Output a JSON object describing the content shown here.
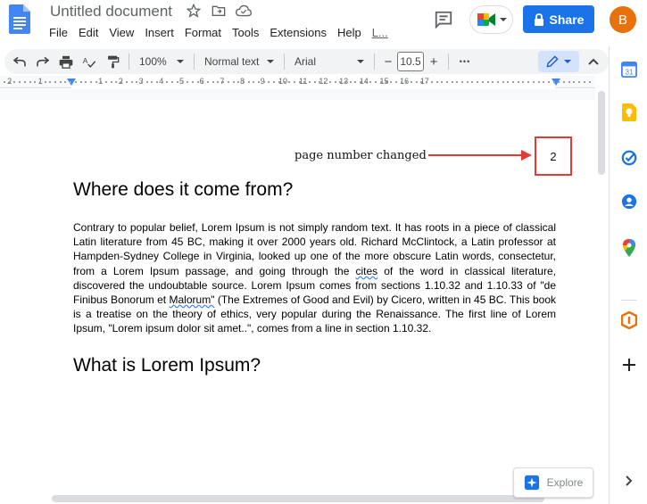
{
  "doc": {
    "title": "Untitled document"
  },
  "menu": [
    "File",
    "Edit",
    "View",
    "Insert",
    "Format",
    "Tools",
    "Extensions",
    "Help",
    "L..."
  ],
  "share": {
    "label": "Share"
  },
  "user": {
    "initial": "B",
    "color": "#e8710a"
  },
  "toolbar": {
    "zoom": "100%",
    "style": "Normal text",
    "font": "Arial",
    "font_size": "10.5",
    "minus": "−",
    "plus": "+",
    "more": "•••"
  },
  "ruler": {
    "numbers": [
      "2",
      "1",
      "1",
      "2",
      "3",
      "4",
      "5",
      "6",
      "7",
      "8",
      "9",
      "10",
      "11",
      "12",
      "13",
      "14",
      "15",
      "16",
      "17"
    ]
  },
  "page": {
    "annotation": "page number changed",
    "page_number": "2",
    "heading1": "Where does it come from?",
    "paragraph_parts": {
      "before_cites": "Contrary to popular belief, Lorem Ipsum is not simply random text. It has roots in a piece of classical Latin literature from 45 BC, making it over 2000 years old. Richard McClintock, a Latin professor at Hampden-Sydney College in Virginia, looked up one of the more obscure Latin words, consectetur, from a Lorem Ipsum passage, and going through the ",
      "cites": "cites",
      "after_cites": " of the word in classical literature, discovered the undoubtable source. Lorem Ipsum comes from sections 1.10.32 and 1.10.33 of \"de Finibus Bonorum et ",
      "malorum": "Malorum\"",
      "after_malorum": " (The Extremes of Good and Evil) by Cicero, written in 45 BC. This book is a treatise on the theory of ethics, very popular during the Renaissance. The first line of Lorem Ipsum, \"Lorem ipsum dolor sit amet..\", comes from a line in section 1.10.32."
    },
    "heading2": "What is Lorem Ipsum?"
  },
  "explore": {
    "label": "Explore"
  },
  "colors": {
    "accent": "#1a73e8",
    "annotation_red": "#e53935"
  },
  "side_panel": [
    "calendar-icon",
    "keep-icon",
    "tasks-icon",
    "contacts-icon",
    "maps-icon",
    "office-icon",
    "add-icon",
    "expand-icon"
  ]
}
